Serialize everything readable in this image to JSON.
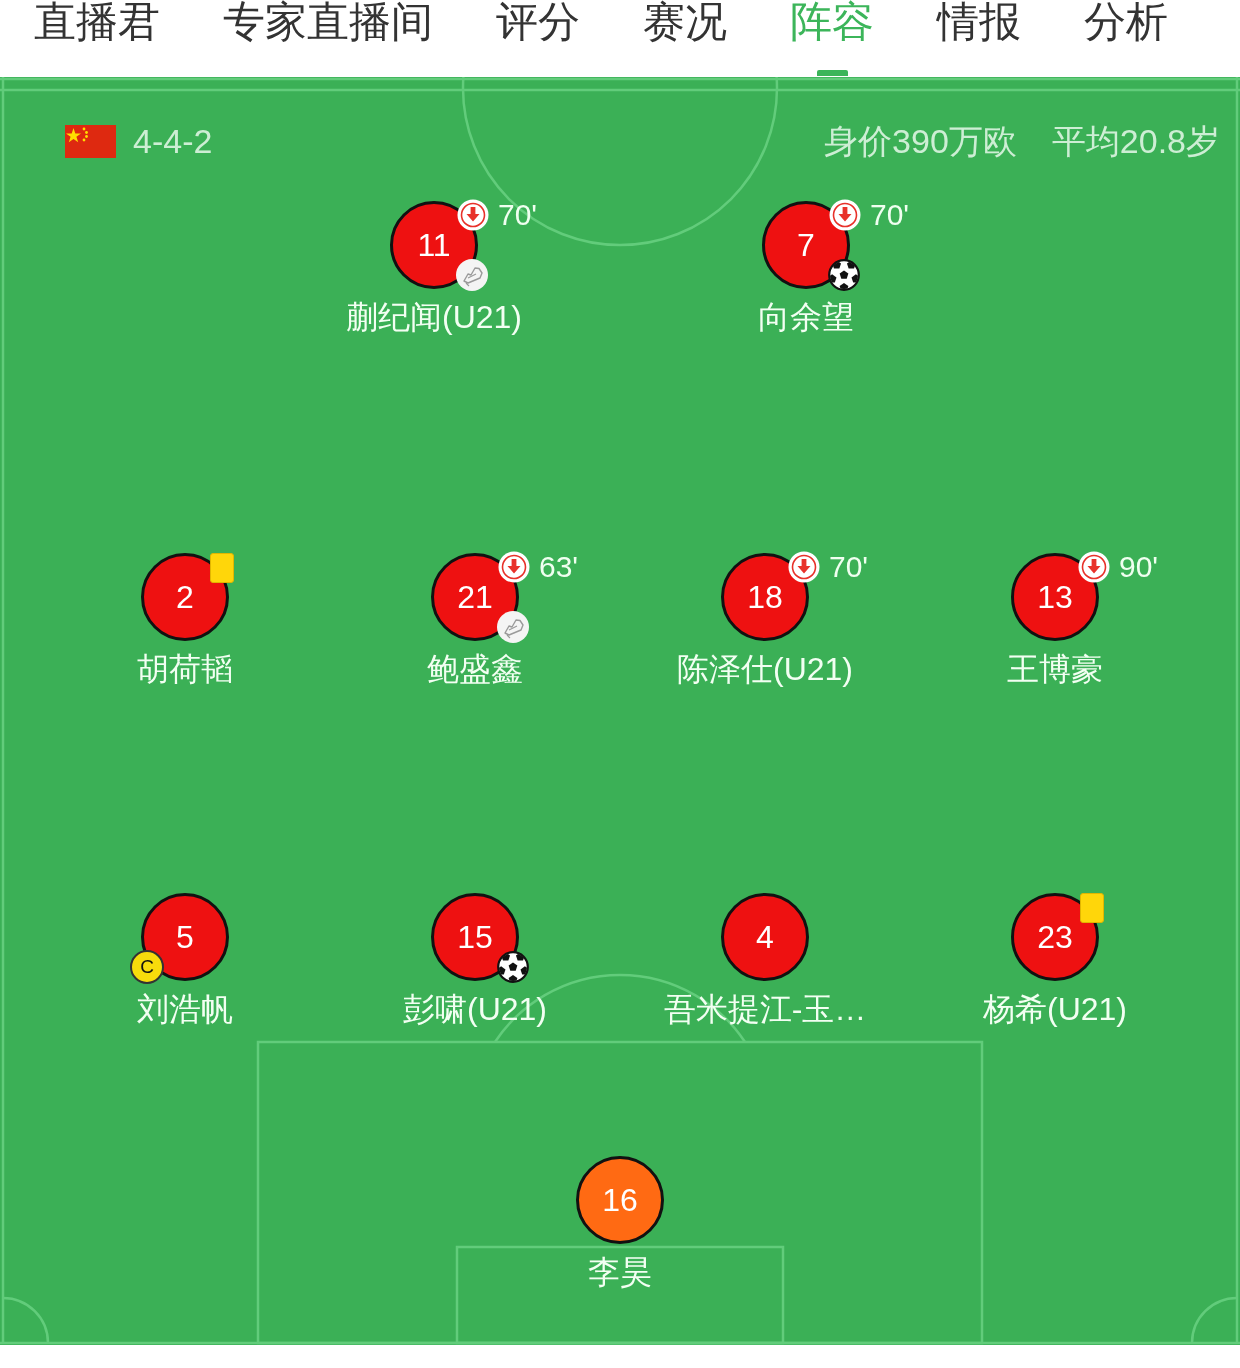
{
  "tabs": [
    {
      "label": "直播君",
      "selected": false
    },
    {
      "label": "专家直播间",
      "selected": false
    },
    {
      "label": "评分",
      "selected": false
    },
    {
      "label": "赛况",
      "selected": false
    },
    {
      "label": "阵容",
      "selected": true
    },
    {
      "label": "情报",
      "selected": false
    },
    {
      "label": "分析",
      "selected": false
    }
  ],
  "lineup": {
    "formation": "4-4-2",
    "market_value": "身价390万欧",
    "average_age": "平均20.8岁",
    "lines": [
      {
        "players": [
          {
            "number": "11",
            "name": "蒯纪闻(U21)",
            "color": "#ee1111",
            "badges": [
              {
                "kind": "substitution",
                "minute": "70'"
              },
              {
                "kind": "assist"
              }
            ]
          },
          {
            "number": "7",
            "name": "向余望",
            "color": "#ee1111",
            "badges": [
              {
                "kind": "substitution",
                "minute": "70'"
              },
              {
                "kind": "goal"
              }
            ]
          }
        ]
      },
      {
        "players": [
          {
            "number": "2",
            "name": "胡荷韬",
            "color": "#ee1111",
            "badges": [
              {
                "kind": "yellow_card"
              }
            ]
          },
          {
            "number": "21",
            "name": "鲍盛鑫",
            "color": "#ee1111",
            "badges": [
              {
                "kind": "substitution",
                "minute": "63'"
              },
              {
                "kind": "assist"
              }
            ]
          },
          {
            "number": "18",
            "name": "陈泽仕(U21)",
            "color": "#ee1111",
            "badges": [
              {
                "kind": "substitution",
                "minute": "70'"
              }
            ]
          },
          {
            "number": "13",
            "name": "王博豪",
            "color": "#ee1111",
            "badges": [
              {
                "kind": "substitution",
                "minute": "90'"
              }
            ]
          }
        ]
      },
      {
        "players": [
          {
            "number": "5",
            "name": "刘浩帆",
            "color": "#ee1111",
            "badges": [
              {
                "kind": "captain",
                "label": "C"
              }
            ]
          },
          {
            "number": "15",
            "name": "彭啸(U21)",
            "color": "#ee1111",
            "badges": [
              {
                "kind": "goal"
              }
            ]
          },
          {
            "number": "4",
            "name": "吾米提江-玉…",
            "color": "#ee1111"
          },
          {
            "number": "23",
            "name": "杨希(U21)",
            "color": "#ee1111",
            "badges": [
              {
                "kind": "yellow_card"
              }
            ]
          }
        ]
      },
      {
        "players": [
          {
            "number": "16",
            "name": "李昊",
            "color": "#ff6a13"
          }
        ]
      }
    ]
  }
}
